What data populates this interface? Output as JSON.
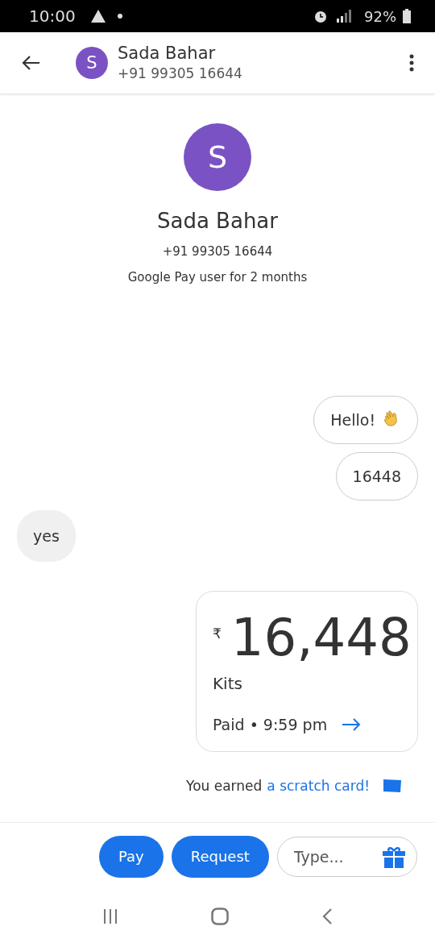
{
  "status_bar": {
    "time": "10:00",
    "battery": "92%"
  },
  "header": {
    "avatar_letter": "S",
    "name": "Sada Bahar",
    "phone": "+91 99305 16644"
  },
  "profile": {
    "avatar_letter": "S",
    "name": "Sada Bahar",
    "phone": "+91 99305 16644",
    "note": "Google Pay user for 2 months"
  },
  "messages": [
    {
      "kind": "sent",
      "text": "Hello!",
      "wave": true
    },
    {
      "kind": "sent",
      "text": "16448",
      "wave": false
    },
    {
      "kind": "received",
      "text": "yes",
      "wave": false
    },
    {
      "kind": "payment",
      "currency": "₹",
      "amount": "16,448",
      "note": "Kits",
      "status": "Paid • 9:59 pm"
    }
  ],
  "reward": {
    "text": "You earned",
    "link": "a scratch card!"
  },
  "composer": {
    "buttons": [
      "Pay",
      "Request"
    ],
    "placeholder": "Type..."
  }
}
